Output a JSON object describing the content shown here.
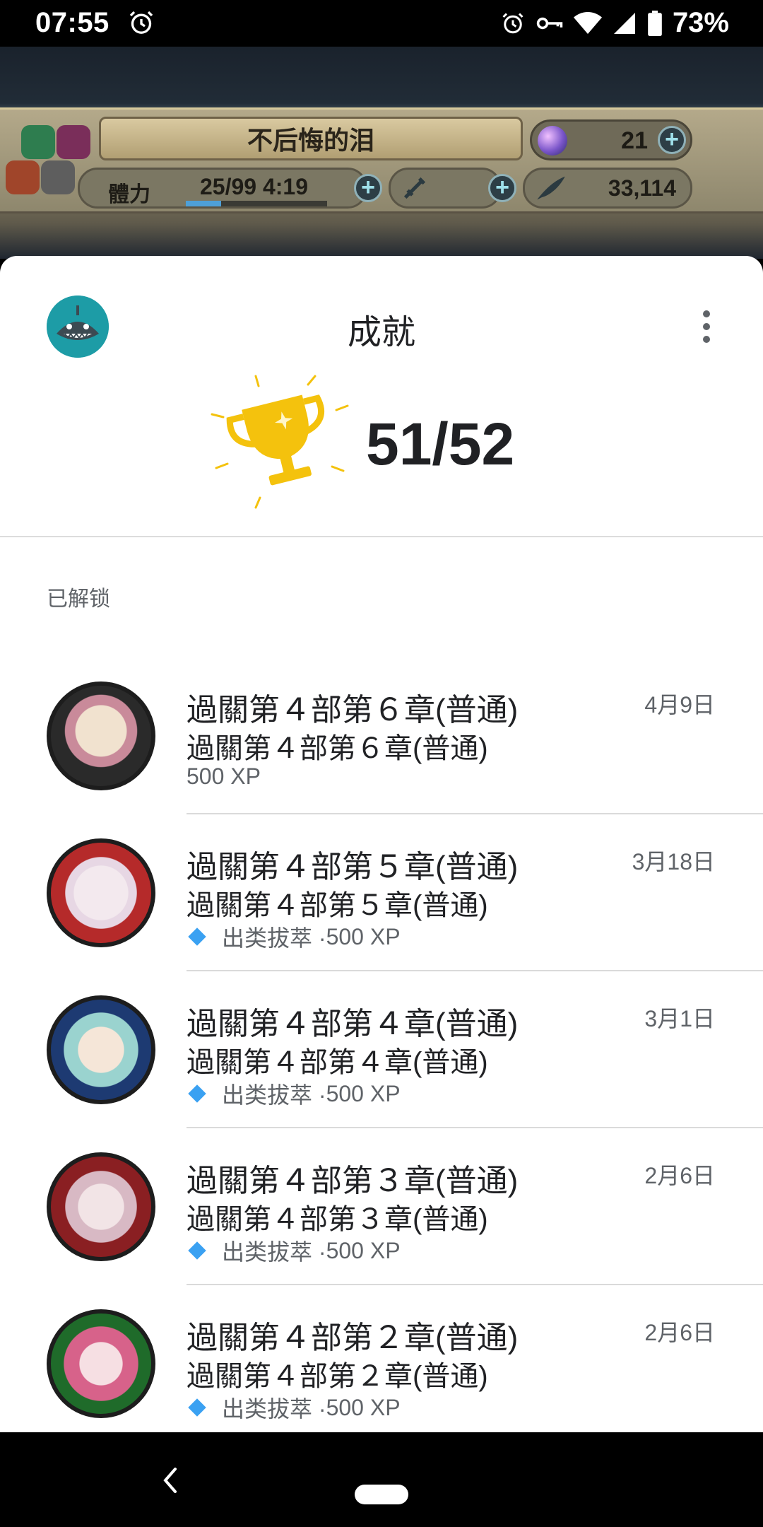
{
  "status_bar": {
    "time": "07:55",
    "battery": "73%",
    "icons": [
      "alarm-icon",
      "alarm-icon",
      "vpn-key-icon",
      "wifi-icon",
      "signal-icon",
      "battery-icon"
    ]
  },
  "game": {
    "title": "不后悔的泪",
    "orbs": "21",
    "stamina_label": "體力",
    "stamina": "25/99",
    "stamina_timer": "4:19",
    "feathers": "33,114"
  },
  "sheet": {
    "title": "成就",
    "score": "51/52",
    "section_label": "已解锁"
  },
  "achievements": [
    {
      "title": "過關第４部第６章(普通)",
      "description": "過關第４部第６章(普通)",
      "meta": "500 XP",
      "rarity": "",
      "date": "4月9日",
      "badge_color": "#2a2a2a"
    },
    {
      "title": "過關第４部第５章(普通)",
      "description": "過關第４部第５章(普通)",
      "meta": "500 XP",
      "rarity": "出类拔萃 · ",
      "date": "3月18日",
      "badge_color": "#b52a2a"
    },
    {
      "title": "過關第４部第４章(普通)",
      "description": "過關第４部第４章(普通)",
      "meta": "500 XP",
      "rarity": "出类拔萃 · ",
      "date": "3月1日",
      "badge_color": "#1d3a72"
    },
    {
      "title": "過關第４部第３章(普通)",
      "description": "過關第４部第３章(普通)",
      "meta": "500 XP",
      "rarity": "出类拔萃 · ",
      "date": "2月6日",
      "badge_color": "#8a1f22"
    },
    {
      "title": "過關第４部第２章(普通)",
      "description": "過關第４部第２章(普通)",
      "meta": "500 XP",
      "rarity": "出类拔萃 · ",
      "date": "2月6日",
      "badge_color": "#1f6b2a"
    }
  ],
  "colors": {
    "accent_diamond": "#3aa1f2",
    "trophy": "#f4c20d"
  }
}
